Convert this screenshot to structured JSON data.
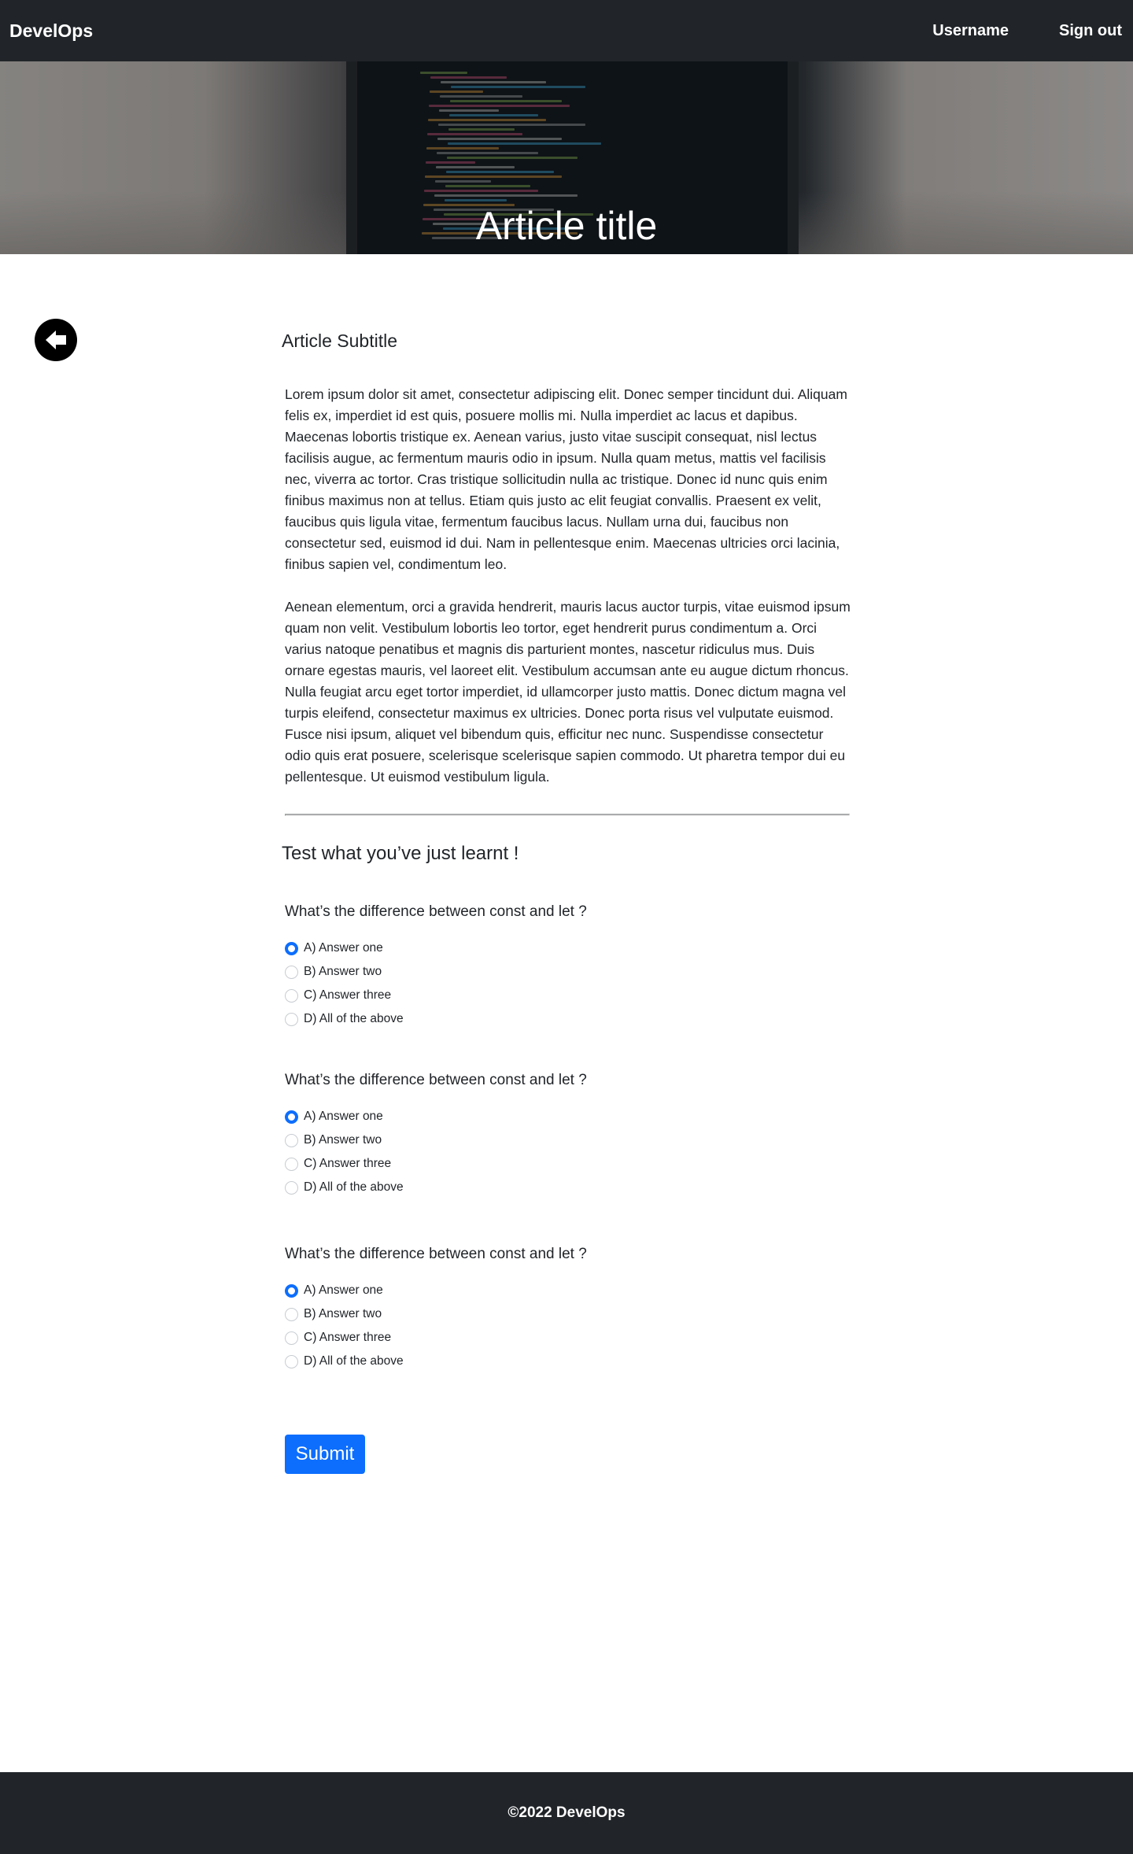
{
  "navbar": {
    "brand": "DevelOps",
    "username": "Username",
    "signout": "Sign out"
  },
  "hero": {
    "title": "Article title"
  },
  "article": {
    "subtitle": "Article Subtitle",
    "paragraphs": [
      "Lorem ipsum dolor sit amet, consectetur adipiscing elit. Donec semper tincidunt dui. Aliquam felis ex, imperdiet id est quis, posuere mollis mi. Nulla imperdiet ac lacus et dapibus. Maecenas lobortis tristique ex. Aenean varius, justo vitae suscipit consequat, nisl lectus facilisis augue, ac fermentum mauris odio in ipsum. Nulla quam metus, mattis vel facilisis nec, viverra ac tortor. Cras tristique sollicitudin nulla ac tristique. Donec id nunc quis enim finibus maximus non at tellus. Etiam quis justo ac elit feugiat convallis. Praesent ex velit, faucibus quis ligula vitae, fermentum faucibus lacus. Nullam urna dui, faucibus non consectetur sed, euismod id dui. Nam in pellentesque enim. Maecenas ultricies orci lacinia, finibus sapien vel, condimentum leo.",
      "Aenean elementum, orci a gravida hendrerit, mauris lacus auctor turpis, vitae euismod ipsum quam non velit. Vestibulum lobortis leo tortor, eget hendrerit purus condimentum a. Orci varius natoque penatibus et magnis dis parturient montes, nascetur ridiculus mus. Duis ornare egestas mauris, vel laoreet elit. Vestibulum accumsan ante eu augue dictum rhoncus. Nulla feugiat arcu eget tortor imperdiet, id ullamcorper justo mattis. Donec dictum magna vel turpis eleifend, consectetur maximus ex ultricies. Donec porta risus vel vulputate euismod. Fusce nisi ipsum, aliquet vel bibendum quis, efficitur nec nunc. Suspendisse consectetur odio quis erat posuere, scelerisque scelerisque sapien commodo. Ut pharetra tempor dui eu pellentesque. Ut euismod vestibulum ligula."
    ]
  },
  "quiz": {
    "heading": "Test what you’ve just learnt !",
    "questions": [
      {
        "text": "What’s the difference between const and let ?",
        "options": [
          "A)  Answer one",
          "B) Answer two",
          "C) Answer three",
          "D) All of the above"
        ],
        "selected": 0
      },
      {
        "text": "What’s the difference between const and let ?",
        "options": [
          "A)  Answer one",
          "B) Answer two",
          "C) Answer three",
          "D) All of the above"
        ],
        "selected": 0
      },
      {
        "text": "What’s the difference between const and let ?",
        "options": [
          "A)  Answer one",
          "B) Answer two",
          "C) Answer three",
          "D) All of the above"
        ],
        "selected": 0
      }
    ],
    "submit_label": "Submit"
  },
  "footer": {
    "text": "©2022 DevelOps"
  },
  "icons": {
    "back": "arrow-left-circle-icon"
  },
  "colors": {
    "navbar_bg": "#212529",
    "accent": "#0d6efd",
    "footer_bg": "#212529"
  }
}
